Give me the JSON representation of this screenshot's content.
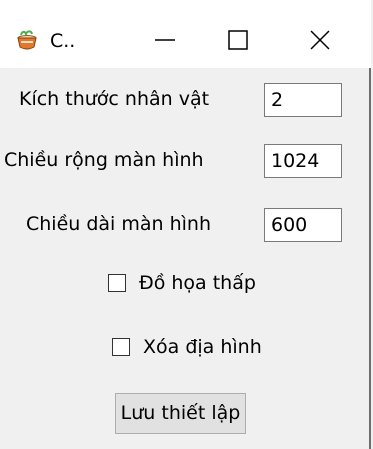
{
  "window": {
    "title": "C..",
    "icon": "teacup-icon",
    "controls": {
      "minimize": "minimize-icon",
      "maximize": "maximize-icon",
      "close": "close-icon"
    }
  },
  "form": {
    "character_size": {
      "label": "Kích thước nhân vật",
      "value": "2"
    },
    "screen_width": {
      "label": "Chiều rộng màn hình",
      "value": "1024"
    },
    "screen_height": {
      "label": "Chiều dài màn hình",
      "value": "600"
    },
    "low_graphics": {
      "label": "Đồ họa thấp",
      "checked": false
    },
    "clear_terrain": {
      "label": "Xóa địa hình",
      "checked": false
    },
    "save_label": "Lưu thiết lập"
  },
  "colors": {
    "background": "#f0f0f0",
    "titlebar": "#ffffff",
    "button_face": "#e1e1e1",
    "input_border": "#7a7a7a"
  }
}
